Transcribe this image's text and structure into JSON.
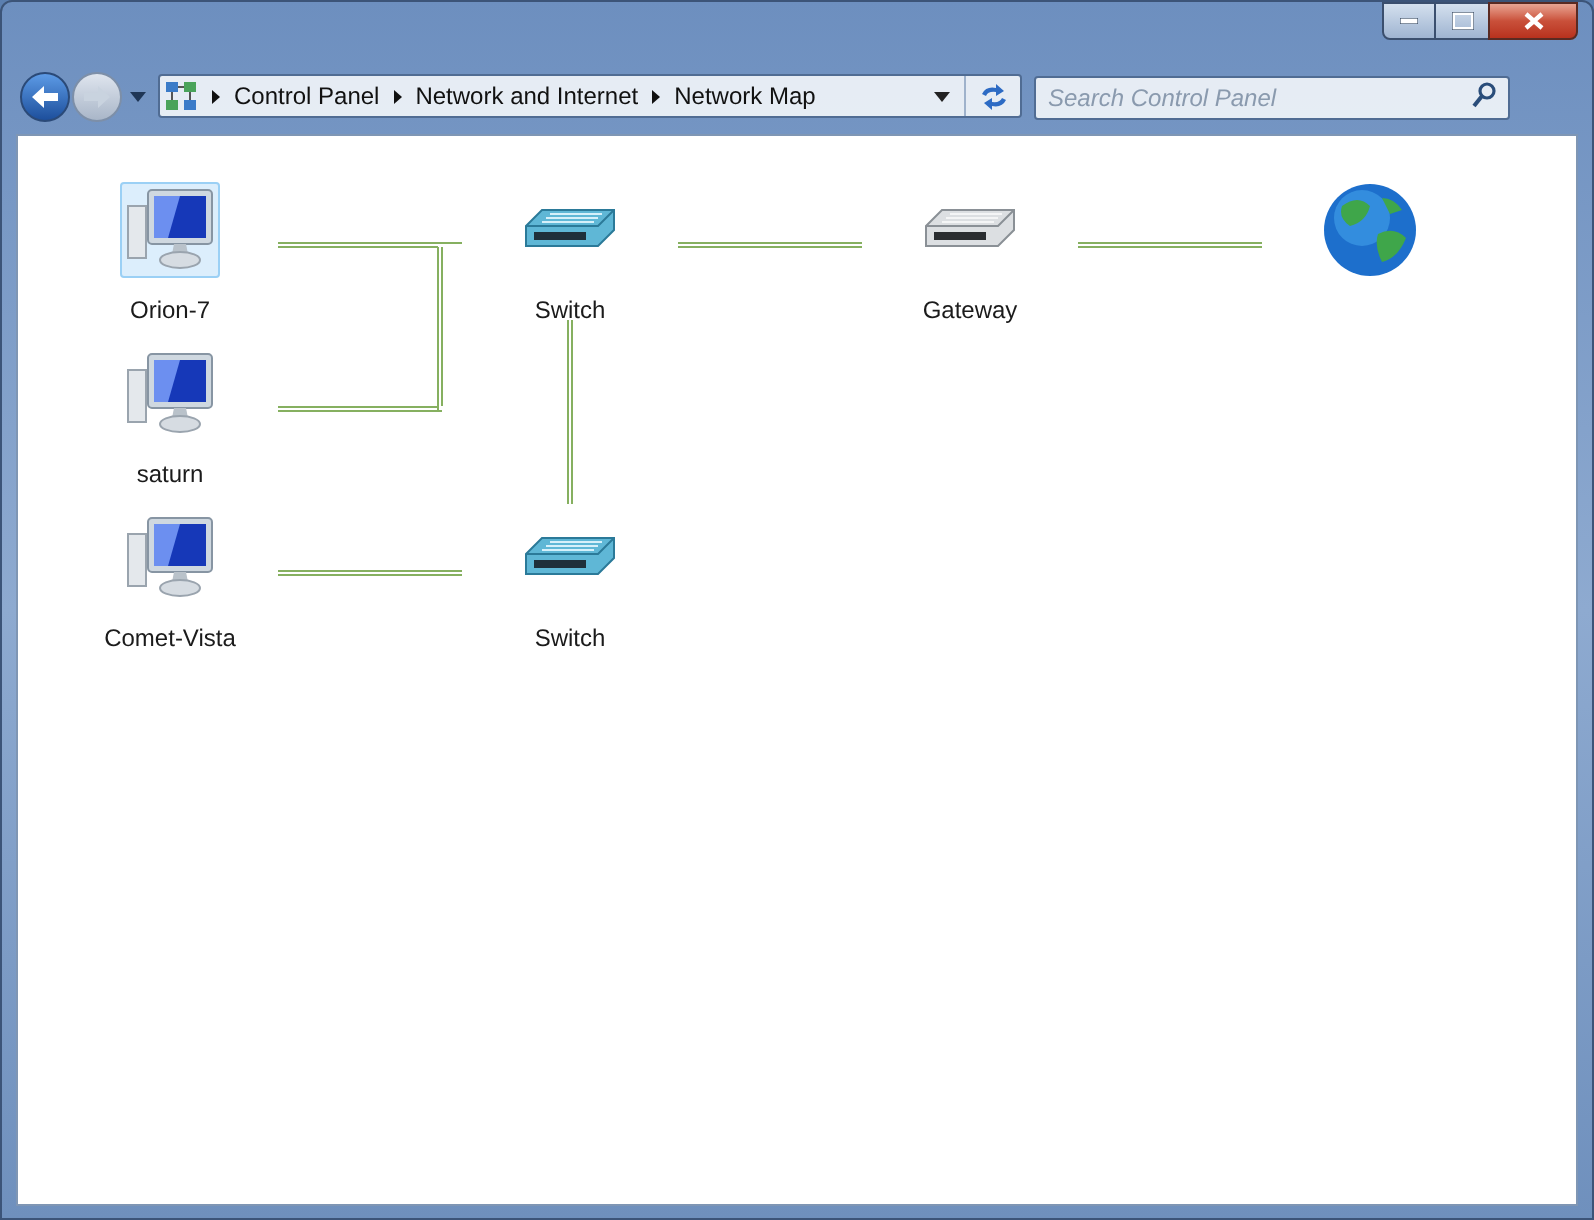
{
  "address_bar": {
    "breadcrumbs": [
      "Control Panel",
      "Network and Internet",
      "Network Map"
    ],
    "back_enabled": true,
    "forward_enabled": false
  },
  "search": {
    "placeholder": "Search Control Panel"
  },
  "map": {
    "rows": [
      [
        {
          "kind": "computer",
          "label": "Orion-7",
          "selected": true
        },
        {
          "kind": "switch",
          "label": "Switch"
        },
        {
          "kind": "gateway",
          "label": "Gateway"
        },
        {
          "kind": "internet"
        }
      ],
      [
        {
          "kind": "computer",
          "label": "saturn",
          "selected": false
        }
      ],
      [
        {
          "kind": "computer",
          "label": "Comet-Vista",
          "selected": false
        },
        {
          "kind": "switch",
          "label": "Switch"
        }
      ]
    ]
  }
}
